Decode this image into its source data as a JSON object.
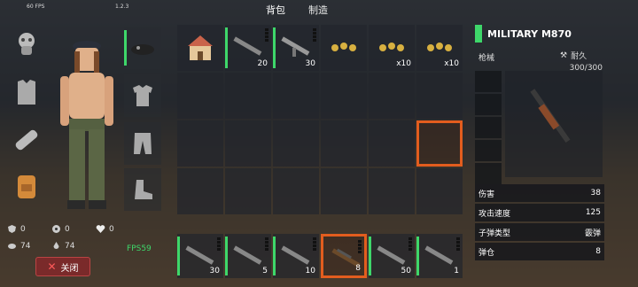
{
  "hud": {
    "fps_top": "60 FPS",
    "version": "1.2.3",
    "fps_bottom": "FPS59"
  },
  "tabs": [
    {
      "label": "背包",
      "active": true
    },
    {
      "label": "制造",
      "active": false
    }
  ],
  "left_gear": [
    {
      "name": "gas-mask-icon"
    },
    {
      "name": "body-armor-icon"
    },
    {
      "name": "bandage-icon"
    },
    {
      "name": "backpack-icon"
    }
  ],
  "clothing": [
    {
      "name": "beret-icon",
      "equipped": true
    },
    {
      "name": "shirt-icon",
      "equipped": false
    },
    {
      "name": "pants-icon",
      "equipped": false
    },
    {
      "name": "boots-icon",
      "equipped": false
    }
  ],
  "stats": [
    {
      "icon": "armor-stat-icon",
      "value": "0"
    },
    {
      "icon": "radiation-stat-icon",
      "value": "0"
    },
    {
      "icon": "health-stat-icon",
      "value": "0"
    },
    {
      "icon": "food-stat-icon",
      "value": "74"
    },
    {
      "icon": "water-stat-icon",
      "value": "74"
    }
  ],
  "close_label": "关闭",
  "inventory": [
    {
      "item": "building-icon",
      "count": "",
      "equipped": false
    },
    {
      "item": "rifle-icon",
      "count": "20",
      "equipped": true
    },
    {
      "item": "smg-icon",
      "count": "30",
      "equipped": true
    },
    {
      "item": "ammo-icon",
      "count": "",
      "equipped": false
    },
    {
      "item": "ammo-icon",
      "count": "x10",
      "equipped": false
    },
    {
      "item": "ammo-icon",
      "count": "x10",
      "equipped": false
    }
  ],
  "hotbar": [
    {
      "item": "rifle-icon",
      "count": "30"
    },
    {
      "item": "rifle-icon",
      "count": "5"
    },
    {
      "item": "rifle-icon",
      "count": "10"
    },
    {
      "item": "shotgun-icon",
      "count": "8",
      "selected": true
    },
    {
      "item": "rifle-icon",
      "count": "50"
    },
    {
      "item": "rifle-icon",
      "count": "1"
    }
  ],
  "detail": {
    "name": "MILITARY M870",
    "category": "枪械",
    "durability_label": "耐久",
    "durability": "300/300",
    "stats": [
      {
        "label": "伤害",
        "value": "38"
      },
      {
        "label": "攻击速度",
        "value": "125"
      },
      {
        "label": "子弹类型",
        "value": "霰弹"
      },
      {
        "label": "弹仓",
        "value": "8"
      }
    ]
  },
  "colors": {
    "accent_green": "#3ed76a",
    "select_orange": "#e25d1e"
  }
}
